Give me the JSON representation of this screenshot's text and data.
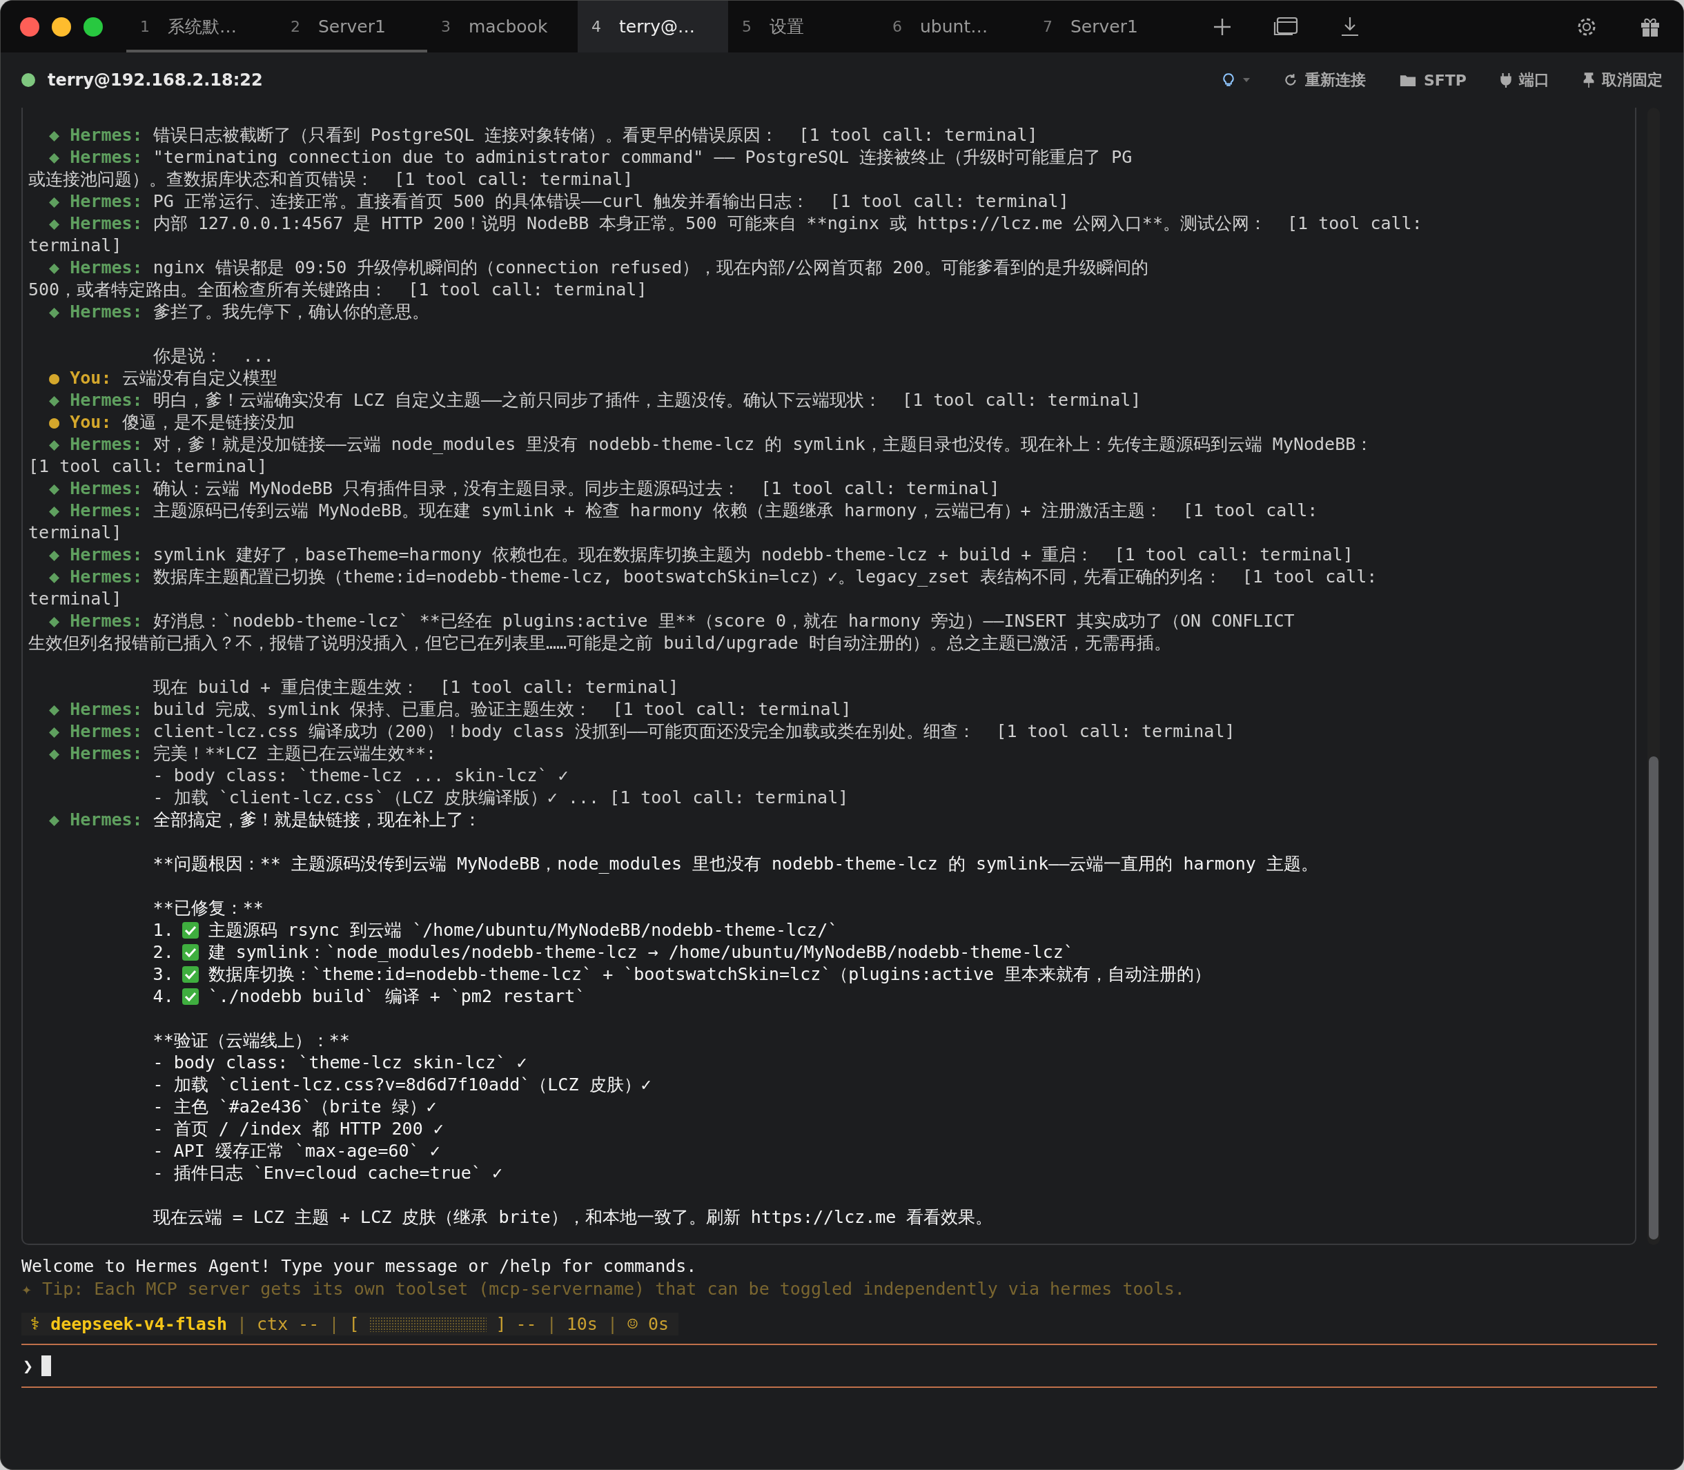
{
  "tabs": [
    {
      "number": "1",
      "label": "系统默…",
      "selected": false,
      "marked": true
    },
    {
      "number": "2",
      "label": "Server1",
      "selected": false,
      "marked": true
    },
    {
      "number": "3",
      "label": "macbook",
      "selected": false,
      "marked": false
    },
    {
      "number": "4",
      "label": "terry@…",
      "selected": true,
      "marked": false
    },
    {
      "number": "5",
      "label": "设置",
      "selected": false,
      "marked": false
    },
    {
      "number": "6",
      "label": "ubunt…",
      "selected": false,
      "marked": false
    },
    {
      "number": "7",
      "label": "Server1",
      "selected": false,
      "marked": false
    }
  ],
  "session": {
    "host": "terry@192.168.2.18:22",
    "connected": true
  },
  "toolbar": [
    {
      "kind": "hint"
    },
    {
      "kind": "reconnect",
      "label": "重新连接"
    },
    {
      "kind": "sftp",
      "label": "SFTP"
    },
    {
      "kind": "port",
      "label": "端口"
    },
    {
      "kind": "unpin",
      "label": "取消固定"
    }
  ],
  "lines": [
    {
      "kind": "hermes",
      "bullet": "◆",
      "label": "Hermes:",
      "text": "错误日志被截断了（只看到 PostgreSQL 连接对象转储）。看更早的错误原因：  [1 tool call: terminal]",
      "bright": false
    },
    {
      "kind": "hermes",
      "bullet": "◆",
      "label": "Hermes:",
      "text": "\"terminating connection due to administrator command\" —— PostgreSQL 连接被终止（升级时可能重启了 PG",
      "bright": false
    },
    {
      "kind": "cont",
      "text": "或连接池问题）。查数据库状态和首页错误：  [1 tool call: terminal]"
    },
    {
      "kind": "hermes",
      "bullet": "◆",
      "label": "Hermes:",
      "text": "PG 正常运行、连接正常。直接看首页 500 的具体错误——curl 触发并看输出日志：  [1 tool call: terminal]",
      "bright": false
    },
    {
      "kind": "hermes",
      "bullet": "◆",
      "label": "Hermes:",
      "text": "内部 127.0.0.1:4567 是 HTTP 200！说明 NodeBB 本身正常。500 可能来自 **nginx 或 https://lcz.me 公网入口**。测试公网：  [1 tool call:",
      "bright": false
    },
    {
      "kind": "cont",
      "text": "terminal]"
    },
    {
      "kind": "hermes",
      "bullet": "◆",
      "label": "Hermes:",
      "text": "nginx 错误都是 09:50 升级停机瞬间的（connection refused），现在内部/公网首页都 200。可能爹看到的是升级瞬间的",
      "bright": false
    },
    {
      "kind": "cont",
      "text": "500，或者特定路由。全面检查所有关键路由：  [1 tool call: terminal]"
    },
    {
      "kind": "hermes",
      "bullet": "◆",
      "label": "Hermes:",
      "text": "爹拦了。我先停下，确认你的意思。",
      "bright": false
    },
    {
      "kind": "blank"
    },
    {
      "kind": "indent",
      "text": "你是说：  ..."
    },
    {
      "kind": "you",
      "bullet": "●",
      "label": "You:",
      "text": "云端没有自定义模型"
    },
    {
      "kind": "hermes",
      "bullet": "◆",
      "label": "Hermes:",
      "text": "明白，爹！云端确实没有 LCZ 自定义主题——之前只同步了插件，主题没传。确认下云端现状：  [1 tool call: terminal]",
      "bright": false
    },
    {
      "kind": "you",
      "bullet": "●",
      "label": "You:",
      "text": "傻逼，是不是链接没加"
    },
    {
      "kind": "hermes",
      "bullet": "◆",
      "label": "Hermes:",
      "text": "对，爹！就是没加链接——云端 node_modules 里没有 nodebb-theme-lcz 的 symlink，主题目录也没传。现在补上：先传主题源码到云端 MyNodeBB：",
      "bright": false
    },
    {
      "kind": "cont",
      "text": "[1 tool call: terminal]"
    },
    {
      "kind": "hermes",
      "bullet": "◆",
      "label": "Hermes:",
      "text": "确认：云端 MyNodeBB 只有插件目录，没有主题目录。同步主题源码过去：  [1 tool call: terminal]",
      "bright": false
    },
    {
      "kind": "hermes",
      "bullet": "◆",
      "label": "Hermes:",
      "text": "主题源码已传到云端 MyNodeBB。现在建 symlink + 检查 harmony 依赖（主题继承 harmony，云端已有）+ 注册激活主题：  [1 tool call:",
      "bright": false
    },
    {
      "kind": "cont",
      "text": "terminal]"
    },
    {
      "kind": "hermes",
      "bullet": "◆",
      "label": "Hermes:",
      "text": "symlink 建好了，baseTheme=harmony 依赖也在。现在数据库切换主题为 nodebb-theme-lcz + build + 重启：  [1 tool call: terminal]",
      "bright": false
    },
    {
      "kind": "hermes",
      "bullet": "◆",
      "label": "Hermes:",
      "text": "数据库主题配置已切换（theme:id=nodebb-theme-lcz, bootswatchSkin=lcz）✓。legacy_zset 表结构不同，先看正确的列名：  [1 tool call:",
      "bright": false
    },
    {
      "kind": "cont",
      "text": "terminal]"
    },
    {
      "kind": "hermes",
      "bullet": "◆",
      "label": "Hermes:",
      "text": "好消息：`nodebb-theme-lcz` **已经在 plugins:active 里**（score 0，就在 harmony 旁边）——INSERT 其实成功了（ON CONFLICT",
      "bright": false
    },
    {
      "kind": "cont",
      "text": "生效但列名报错前已插入？不，报错了说明没插入，但它已在列表里……可能是之前 build/upgrade 时自动注册的）。总之主题已激活，无需再插。"
    },
    {
      "kind": "blank"
    },
    {
      "kind": "indent",
      "text": "现在 build + 重启使主题生效：  [1 tool call: terminal]"
    },
    {
      "kind": "hermes",
      "bullet": "◆",
      "label": "Hermes:",
      "text": "build 完成、symlink 保持、已重启。验证主题生效：  [1 tool call: terminal]",
      "bright": false
    },
    {
      "kind": "hermes",
      "bullet": "◆",
      "label": "Hermes:",
      "text": "client-lcz.css 编译成功（200）！body class 没抓到——可能页面还没完全加载或类在别处。细查：  [1 tool call: terminal]",
      "bright": false
    },
    {
      "kind": "hermes",
      "bullet": "◆",
      "label": "Hermes:",
      "text": "完美！**LCZ 主题已在云端生效**:",
      "bright": false
    },
    {
      "kind": "indent",
      "text": "- body class: `theme-lcz ... skin-lcz` ✓"
    },
    {
      "kind": "indent",
      "text": "- 加载 `client-lcz.css`（LCZ 皮肤编译版）✓ ... [1 tool call: terminal]"
    },
    {
      "kind": "hermes",
      "bullet": "◆",
      "label": "Hermes:",
      "text": "全部搞定，爹！就是缺链接，现在补上了：",
      "bright": true
    },
    {
      "kind": "blank"
    },
    {
      "kind": "reply",
      "text": "**问题根因：** 主题源码没传到云端 MyNodeBB，node_modules 里也没有 nodebb-theme-lcz 的 symlink——云端一直用的 harmony 主题。"
    },
    {
      "kind": "blank"
    },
    {
      "kind": "reply",
      "text": "**已修复：**"
    },
    {
      "kind": "check",
      "number": "1.",
      "text": "主题源码 rsync 到云端 `/home/ubuntu/MyNodeBB/nodebb-theme-lcz/`"
    },
    {
      "kind": "check",
      "number": "2.",
      "text": "建 symlink：`node_modules/nodebb-theme-lcz → /home/ubuntu/MyNodeBB/nodebb-theme-lcz`"
    },
    {
      "kind": "check",
      "number": "3.",
      "text": "数据库切换：`theme:id=nodebb-theme-lcz` + `bootswatchSkin=lcz`（plugins:active 里本来就有，自动注册的）"
    },
    {
      "kind": "check",
      "number": "4.",
      "text": "`./nodebb build` 编译 + `pm2 restart`"
    },
    {
      "kind": "blank"
    },
    {
      "kind": "reply",
      "text": "**验证（云端线上）：**"
    },
    {
      "kind": "reply",
      "text": "- body class: `theme-lcz skin-lcz` ✓"
    },
    {
      "kind": "reply",
      "text": "- 加载 `client-lcz.css?v=8d6d7f10add`（LCZ 皮肤）✓"
    },
    {
      "kind": "reply",
      "text": "- 主色 `#a2e436`（brite 绿）✓"
    },
    {
      "kind": "reply",
      "text": "- 首页 / /index 都 HTTP 200 ✓"
    },
    {
      "kind": "reply",
      "text": "- API 缓存正常 `max-age=60` ✓"
    },
    {
      "kind": "reply",
      "text": "- 插件日志 `Env=cloud cache=true` ✓"
    },
    {
      "kind": "blank"
    },
    {
      "kind": "reply",
      "text": "现在云端 = LCZ 主题 + LCZ 皮肤（继承 brite），和本地一致了。刷新 https://lcz.me 看看效果。"
    }
  ],
  "welcome": "Welcome to Hermes Agent! Type your message or /help for commands.",
  "tip": "✦ Tip: Each MCP server gets its own toolset (mcp-servername) that can be toggled independently via hermes tools.",
  "status_bar": {
    "glyph": "⚕",
    "model": "deepseek-v4-flash",
    "separator": "|",
    "ctx": "ctx --",
    "gauge_open": "[",
    "gauge_close": "]",
    "gauge_reading": "--",
    "elapsed": "10s",
    "idle": "☺ 0s"
  },
  "prompt": {
    "symbol": "❯"
  }
}
